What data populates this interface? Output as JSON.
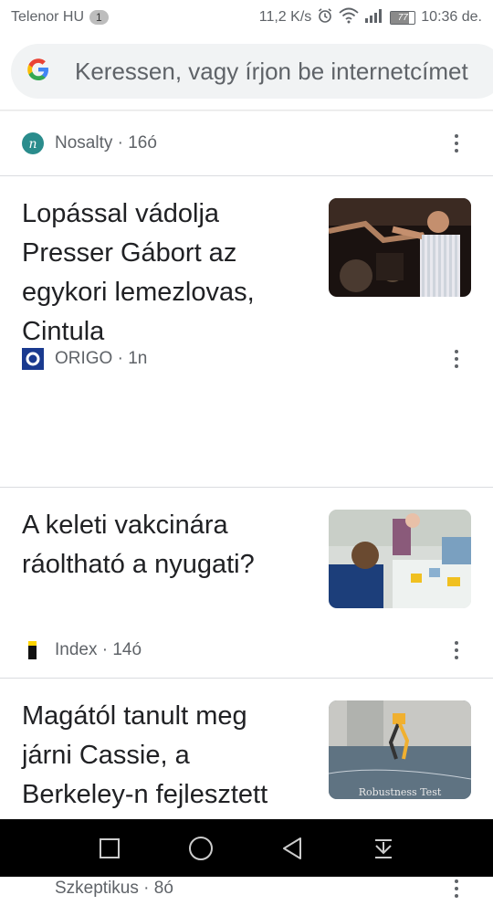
{
  "status_bar": {
    "carrier": "Telenor HU",
    "carrier_badge": "1",
    "speed": "11,2 K/s",
    "battery": "77",
    "time": "10:36 de."
  },
  "search": {
    "placeholder": "Keressen, vagy írjon be internetcímet"
  },
  "feed": {
    "top_meta": {
      "source": "Nosalty · 16ó"
    },
    "articles": [
      {
        "title": "Lopással vádolja Presser Gábort az egykori lemezlovas, Cintula",
        "source": "ORIGO · 1n"
      },
      {
        "title": "A keleti vakcinára ráoltható a nyugati?",
        "source": "Index · 14ó"
      },
      {
        "title": "Magától tanult meg járni Cassie, a Berkeley-n fejlesztett kétlábú robot",
        "source": "Szkeptikus · 8ó",
        "thumb_caption": "Robustness Test"
      }
    ]
  },
  "icons": {
    "search_logo": "google-g-icon",
    "more": "more-vert-icon",
    "nav": [
      "recents-square-icon",
      "home-circle-icon",
      "back-triangle-icon",
      "notification-pulldown-icon"
    ]
  },
  "colors": {
    "nosalty": "#2a8c8c",
    "origo": "#1a3a8f",
    "index_yellow": "#ffd400"
  }
}
